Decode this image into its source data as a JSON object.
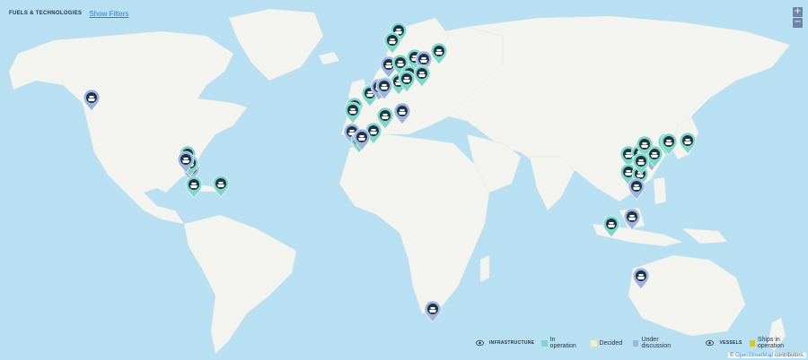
{
  "filters": {
    "title": "FUELS & TECHNOLOGIES",
    "show_filters_label": "Show Filters"
  },
  "zoom": {
    "in_label": "+",
    "out_label": "−"
  },
  "legend": {
    "infrastructure_label": "INFRASTRUCTURE",
    "vessels_label": "VESSELS",
    "categories": [
      {
        "label": "In operation",
        "color": "#7fd6c4"
      },
      {
        "label": "Decided",
        "color": "#f3ecc8"
      },
      {
        "label": "Under discussion",
        "color": "#9fb4dc"
      }
    ],
    "vessel_categories": [
      {
        "label": "Ships in operation",
        "color": "#d6c632"
      }
    ]
  },
  "attribution": {
    "prefix": "© ",
    "link": "OpenStreetMap",
    "suffix": " contributors."
  },
  "colors": {
    "water": "#b8dff2",
    "land": "#f3f4ef",
    "operation": "#7fd6c4",
    "discussion": "#9fb4dc",
    "pin_icon_bg": "#1e3348"
  },
  "markers": [
    {
      "status": "discussion"
    },
    {
      "status": "operation"
    },
    {
      "status": "operation"
    },
    {
      "status": "operation"
    },
    {
      "status": "operation"
    },
    {
      "status": "discussion"
    },
    {
      "status": "operation"
    },
    {
      "status": "discussion"
    },
    {
      "status": "operation"
    },
    {
      "status": "operation"
    },
    {
      "status": "operation"
    },
    {
      "status": "operation"
    },
    {
      "status": "operation"
    },
    {
      "status": "operation"
    },
    {
      "status": "discussion"
    },
    {
      "status": "discussion"
    },
    {
      "status": "discussion"
    },
    {
      "status": "discussion"
    },
    {
      "status": "operation"
    },
    {
      "status": "operation"
    },
    {
      "status": "operation"
    },
    {
      "status": "operation"
    },
    {
      "status": "discussion"
    },
    {
      "status": "operation"
    },
    {
      "status": "discussion"
    },
    {
      "status": "operation"
    },
    {
      "status": "discussion"
    },
    {
      "status": "operation"
    },
    {
      "status": "operation"
    },
    {
      "status": "operation"
    },
    {
      "status": "operation"
    },
    {
      "status": "operation"
    },
    {
      "status": "operation"
    },
    {
      "status": "discussion"
    },
    {
      "status": "operation"
    },
    {
      "status": "operation"
    },
    {
      "status": "operation"
    },
    {
      "status": "operation"
    },
    {
      "status": "operation"
    },
    {
      "status": "operation"
    },
    {
      "status": "discussion"
    },
    {
      "status": "operation"
    },
    {
      "status": "operation"
    },
    {
      "status": "discussion"
    },
    {
      "status": "operation"
    },
    {
      "status": "discussion"
    },
    {
      "status": "discussion"
    },
    {
      "status": "discussion"
    }
  ]
}
